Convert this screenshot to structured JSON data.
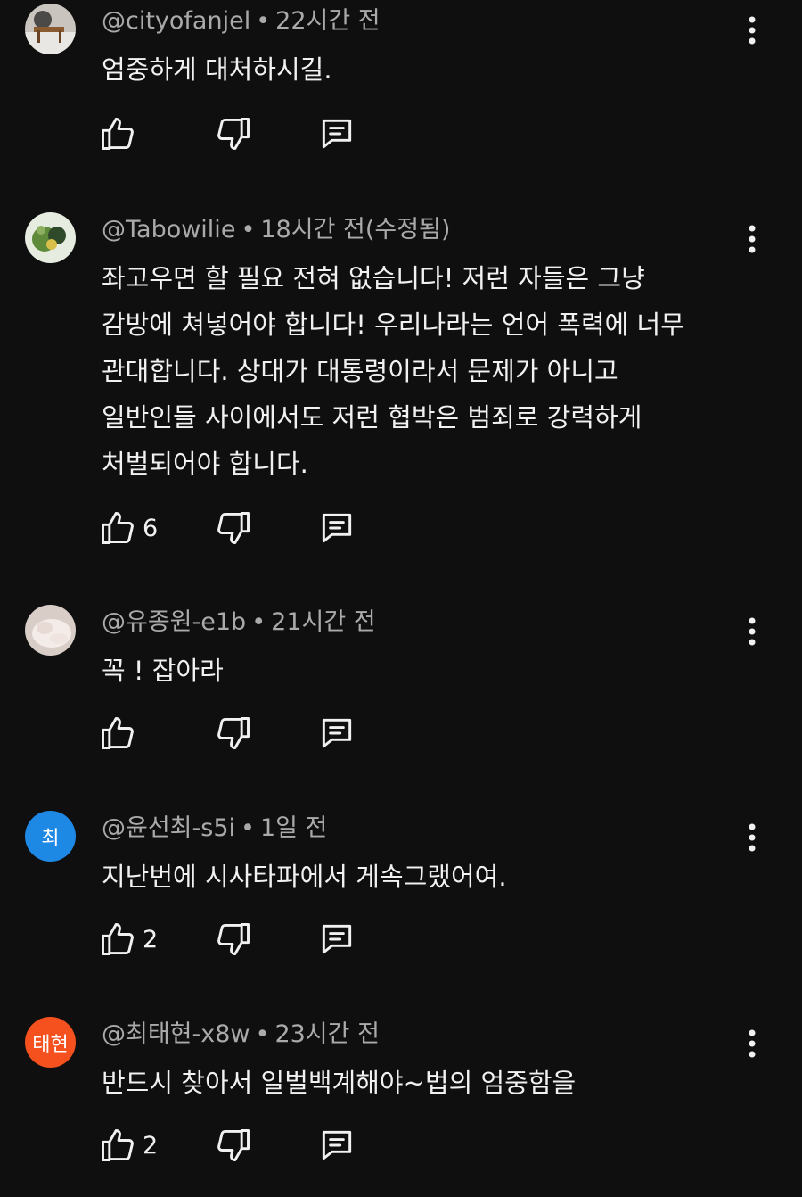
{
  "comments": [
    {
      "username": "@cityofanjel",
      "time": "22시간 전",
      "text": "엄중하게 대처하시길.",
      "likes": "",
      "avatar": {
        "type": "image",
        "icon": "user-photo-avatar",
        "colors": [
          "#c7c1b8",
          "#7a5a3c",
          "#3c3c3c"
        ]
      }
    },
    {
      "username": "@Tabowilie",
      "time": "18시간 전(수정됨)",
      "text": "좌고우면 할 필요 전혀 없습니다! 저런 자들은 그냥\n감방에 쳐넣어야 합니다! 우리나라는 언어 폭력에 너무\n관대합니다. 상대가 대통령이라서 문제가 아니고\n일반인들 사이에서도 저런 협박은 범죄로 강력하게\n처벌되어야 합니다.",
      "likes": "6",
      "avatar": {
        "type": "image",
        "icon": "user-photo-avatar",
        "colors": [
          "#5f8a3a",
          "#d8c04a",
          "#2f4a2a"
        ]
      }
    },
    {
      "username": "@유종원-e1b",
      "time": "21시간 전",
      "text": "꼭 ! 잡아라",
      "likes": "",
      "avatar": {
        "type": "image",
        "icon": "user-photo-avatar",
        "colors": [
          "#e9dfdc",
          "#d7c6c0",
          "#f5efec"
        ]
      }
    },
    {
      "username": "@윤선최-s5i",
      "time": "1일 전",
      "text": "지난번에 시사타파에서 게속그랬어여.",
      "likes": "2",
      "avatar": {
        "type": "initials",
        "label": "최",
        "color": "#1e88e5"
      }
    },
    {
      "username": "@최태현-x8w",
      "time": "23시간 전",
      "text": "반드시 찾아서 일벌백계해야~법의 엄중함을",
      "likes": "2",
      "avatar": {
        "type": "initials",
        "label": "태현",
        "color": "#f4511e"
      }
    }
  ],
  "icons": {
    "like": "thumbs-up-icon",
    "dislike": "thumbs-down-icon",
    "reply": "reply-comment-icon",
    "more": "more-vert-icon"
  },
  "colors": {
    "background": "#0f0f0f",
    "text_primary": "#f1f1f1",
    "text_secondary": "#aaaaaa"
  }
}
